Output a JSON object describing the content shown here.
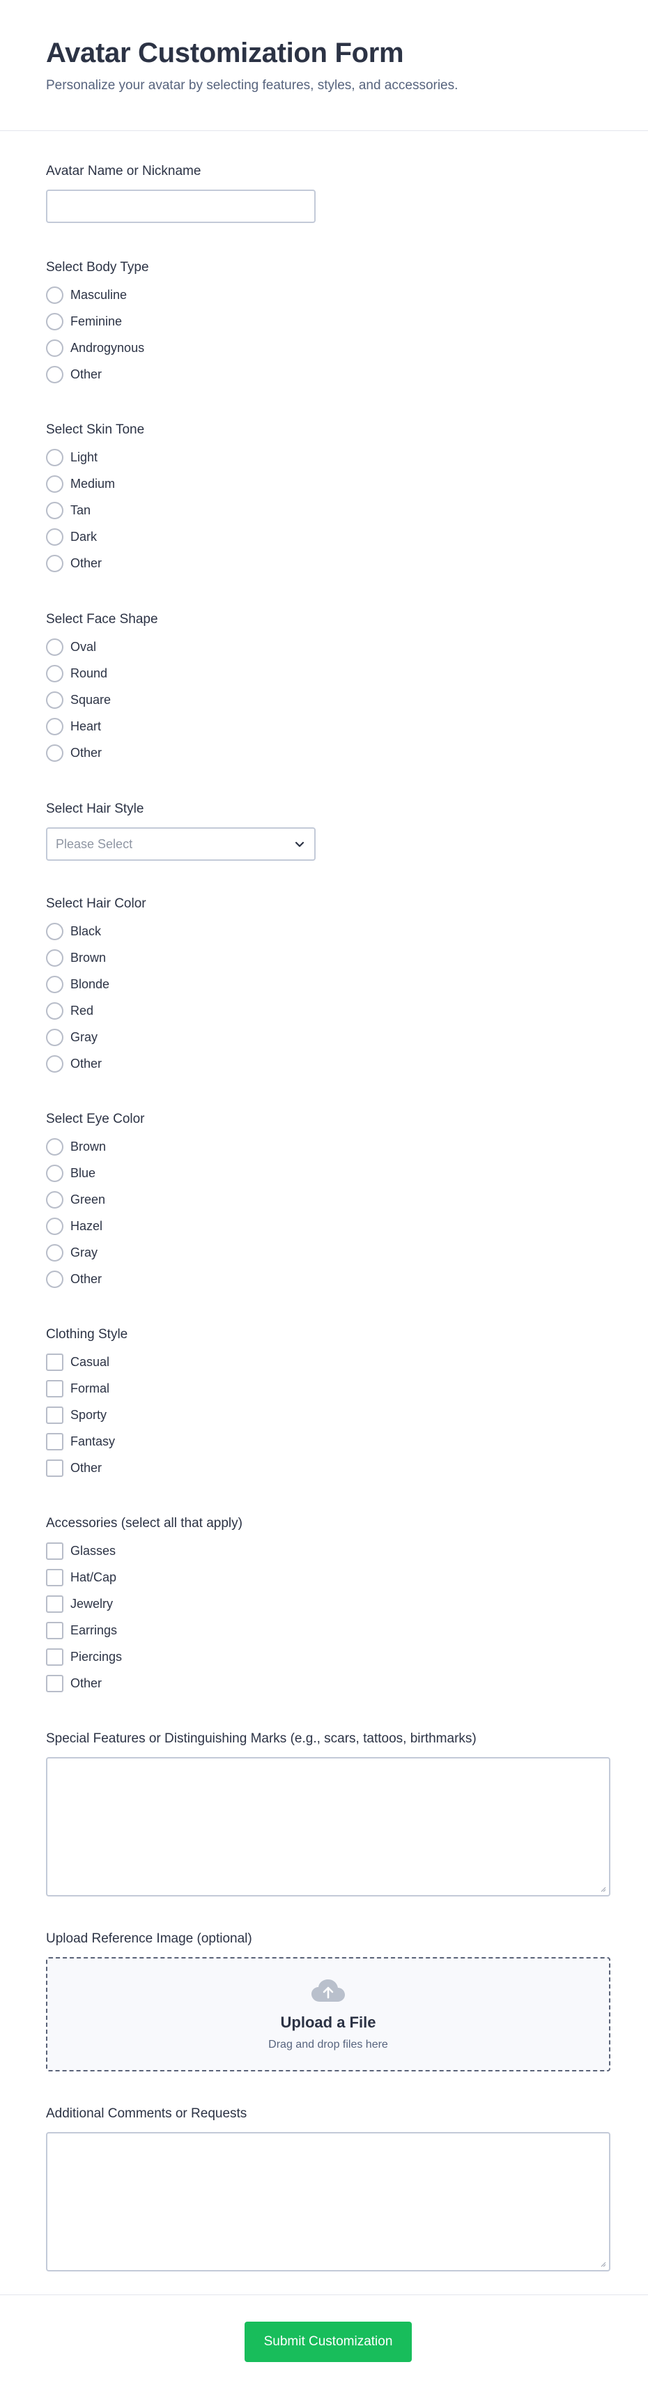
{
  "form": {
    "title": "Avatar Customization Form",
    "subtitle": "Personalize your avatar by selecting features, styles, and accessories."
  },
  "name_field": {
    "label": "Avatar Name or Nickname",
    "value": ""
  },
  "body_type": {
    "label": "Select Body Type",
    "options": [
      "Masculine",
      "Feminine",
      "Androgynous",
      "Other"
    ]
  },
  "skin_tone": {
    "label": "Select Skin Tone",
    "options": [
      "Light",
      "Medium",
      "Tan",
      "Dark",
      "Other"
    ]
  },
  "face_shape": {
    "label": "Select Face Shape",
    "options": [
      "Oval",
      "Round",
      "Square",
      "Heart",
      "Other"
    ]
  },
  "hair_style": {
    "label": "Select Hair Style",
    "placeholder": "Please Select"
  },
  "hair_color": {
    "label": "Select Hair Color",
    "options": [
      "Black",
      "Brown",
      "Blonde",
      "Red",
      "Gray",
      "Other"
    ]
  },
  "eye_color": {
    "label": "Select Eye Color",
    "options": [
      "Brown",
      "Blue",
      "Green",
      "Hazel",
      "Gray",
      "Other"
    ]
  },
  "clothing": {
    "label": "Clothing Style",
    "options": [
      "Casual",
      "Formal",
      "Sporty",
      "Fantasy",
      "Other"
    ]
  },
  "accessories": {
    "label": "Accessories (select all that apply)",
    "options": [
      "Glasses",
      "Hat/Cap",
      "Jewelry",
      "Earrings",
      "Piercings",
      "Other"
    ]
  },
  "special_features": {
    "label": "Special Features or Distinguishing Marks (e.g., scars, tattoos, birthmarks)",
    "value": ""
  },
  "upload": {
    "label": "Upload Reference Image (optional)",
    "title": "Upload a File",
    "subtitle": "Drag and drop files here",
    "icon": "cloud-upload-icon"
  },
  "comments": {
    "label": "Additional Comments or Requests",
    "value": ""
  },
  "submit": {
    "label": "Submit Customization",
    "color": "#18bd5b"
  }
}
